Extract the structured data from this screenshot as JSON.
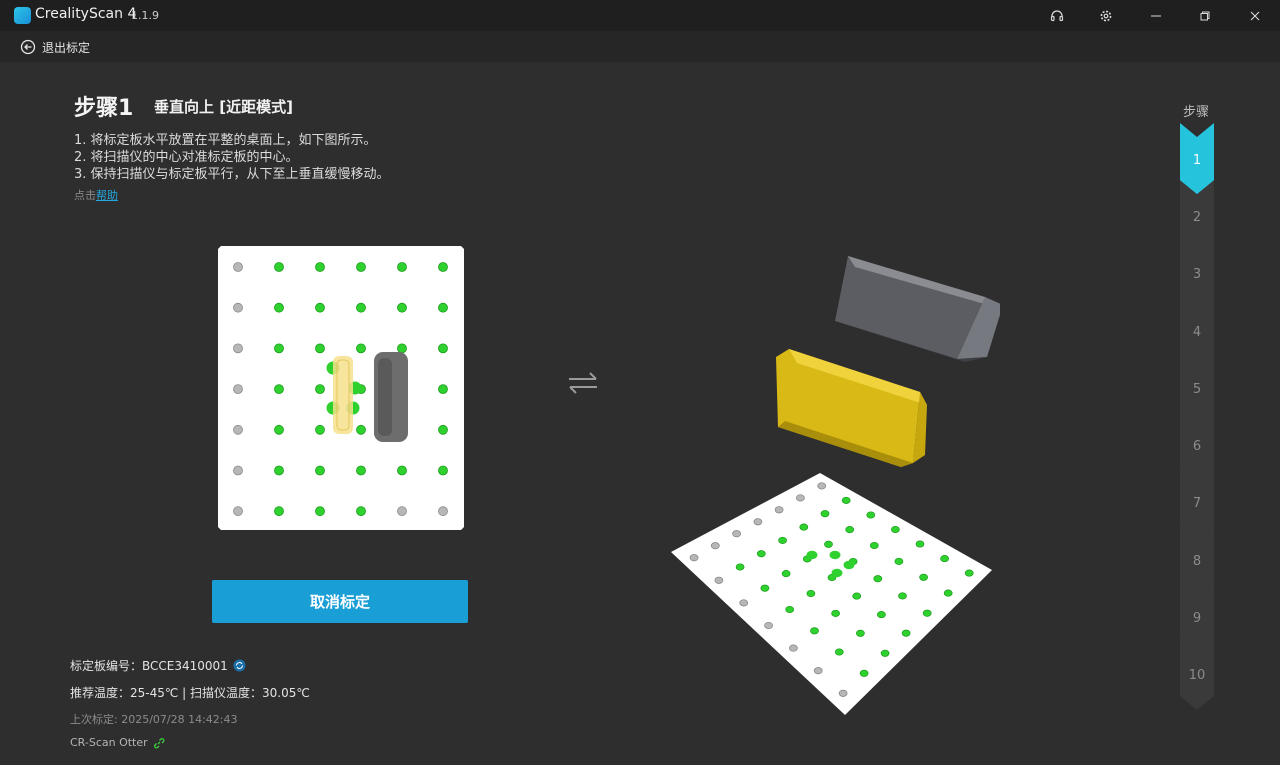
{
  "window": {
    "app_name": "CrealityScan 4",
    "version": "1.1.9"
  },
  "toolbar": {
    "back_label": "退出标定"
  },
  "step": {
    "title": "步骤1",
    "subtitle": "垂直向上 [近距模式]",
    "instructions": [
      "1. 将标定板水平放置在平整的桌面上，如下图所示。",
      "2. 将扫描仪的中心对准标定板的中心。",
      "3. 保持扫描仪与标定板平行，从下至上垂直缓慢移动。"
    ],
    "help_prefix": "点击",
    "help_link": "帮助"
  },
  "cancel_label": "取消标定",
  "info": {
    "board_id": "标定板编号：BCCE3410001",
    "temperature": "推荐温度：25-45℃ | 扫描仪温度：30.05℃",
    "last_calibration": "上次标定: 2025/07/28 14:42:43",
    "device": "CR-Scan Otter"
  },
  "steps_panel": {
    "heading": "步骤",
    "steps": [
      "1",
      "2",
      "3",
      "4",
      "5",
      "6",
      "7",
      "8",
      "9",
      "10"
    ],
    "active_index": 0
  },
  "colors": {
    "accent": "#1a9ed6",
    "active_step": "#25c3dc",
    "dot_green": "#2ed12e",
    "dot_gray": "#b7b7b7",
    "scanner_yellow": "#e6c619"
  },
  "icons": [
    "app-logo-icon",
    "headset-icon",
    "gear-icon",
    "minimize-icon",
    "restore-icon",
    "close-icon",
    "back-arrow-icon",
    "swap-arrows-icon",
    "refresh-icon",
    "link-icon"
  ]
}
